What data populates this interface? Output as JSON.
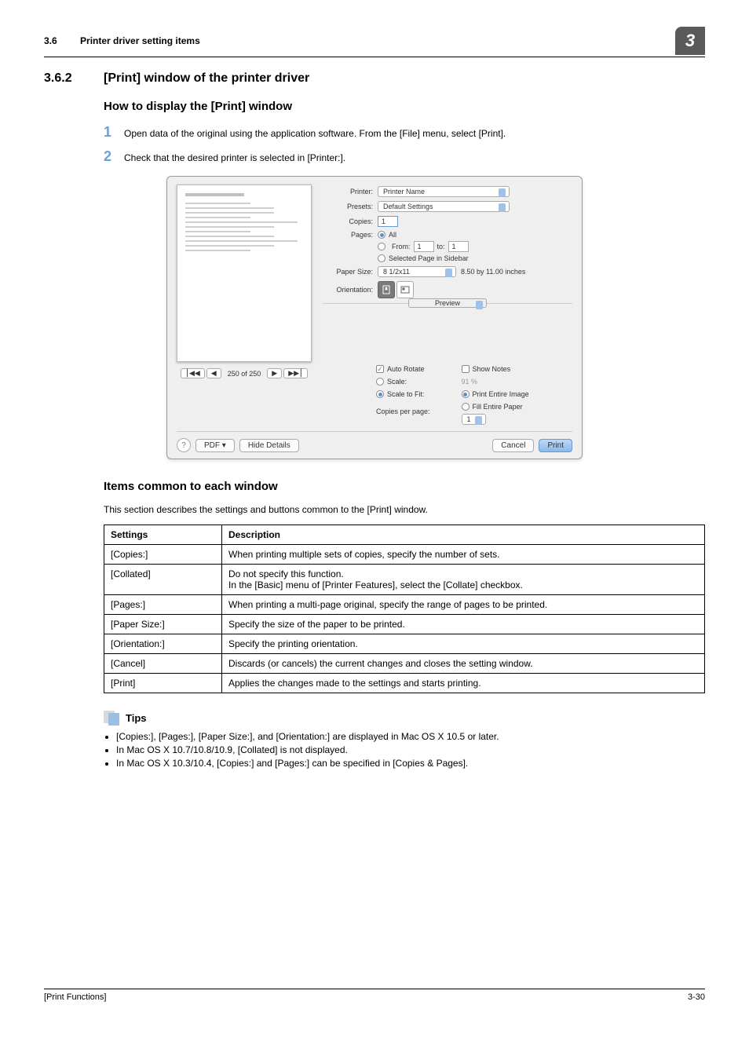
{
  "header": {
    "section_num": "3.6",
    "section_title": "Printer driver setting items",
    "chapter": "3"
  },
  "section": {
    "num": "3.6.2",
    "title": "[Print] window of the printer driver"
  },
  "sub1": "How to display the [Print] window",
  "step1": "Open data of the original using the application software. From the [File] menu, select [Print].",
  "step2": "Check that the desired printer is selected in [Printer:].",
  "dialog": {
    "printer_label": "Printer:",
    "printer_value": "Printer Name",
    "presets_label": "Presets:",
    "presets_value": "Default Settings",
    "copies_label": "Copies:",
    "copies_value": "1",
    "pages_label": "Pages:",
    "pages_all": "All",
    "pages_from": "From:",
    "pages_from_v": "1",
    "pages_to": "to:",
    "pages_to_v": "1",
    "pages_sel": "Selected Page in Sidebar",
    "paper_label": "Paper Size:",
    "paper_value": "8 1/2x11",
    "paper_dim": "8.50 by 11.00 inches",
    "orient_label": "Orientation:",
    "sep_preview": "Preview",
    "auto_rotate": "Auto Rotate",
    "show_notes": "Show Notes",
    "scale": "Scale:",
    "scale_pct": "91 %",
    "scale_fit": "Scale to Fit:",
    "print_entire": "Print Entire Image",
    "fill_paper": "Fill Entire Paper",
    "cpp_label": "Copies per page:",
    "cpp_value": "1",
    "pager": "250 of 250",
    "pdf": "PDF",
    "hide": "Hide Details",
    "cancel": "Cancel",
    "print": "Print"
  },
  "sub2": "Items common to each window",
  "sub2_desc": "This section describes the settings and buttons common to the [Print] window.",
  "table_headers": {
    "c1": "Settings",
    "c2": "Description"
  },
  "rows": [
    {
      "s": "[Copies:]",
      "d": "When printing multiple sets of copies, specify the number of sets."
    },
    {
      "s": "[Collated]",
      "d": "Do not specify this function.\nIn the [Basic] menu of [Printer Features], select the [Collate] checkbox."
    },
    {
      "s": "[Pages:]",
      "d": "When printing a multi-page original, specify the range of pages to be printed."
    },
    {
      "s": "[Paper Size:]",
      "d": "Specify the size of the paper to be printed."
    },
    {
      "s": "[Orientation:]",
      "d": "Specify the printing orientation."
    },
    {
      "s": "[Cancel]",
      "d": "Discards (or cancels) the current changes and closes the setting window."
    },
    {
      "s": "[Print]",
      "d": "Applies the changes made to the settings and starts printing."
    }
  ],
  "tips_label": "Tips",
  "tips": [
    "[Copies:], [Pages:], [Paper Size:], and [Orientation:] are displayed in Mac OS X 10.5 or later.",
    "In Mac OS X 10.7/10.8/10.9, [Collated] is not displayed.",
    "In Mac OS X 10.3/10.4, [Copies:] and [Pages:] can be specified in [Copies & Pages]."
  ],
  "footer": {
    "left": "[Print Functions]",
    "right": "3-30"
  }
}
